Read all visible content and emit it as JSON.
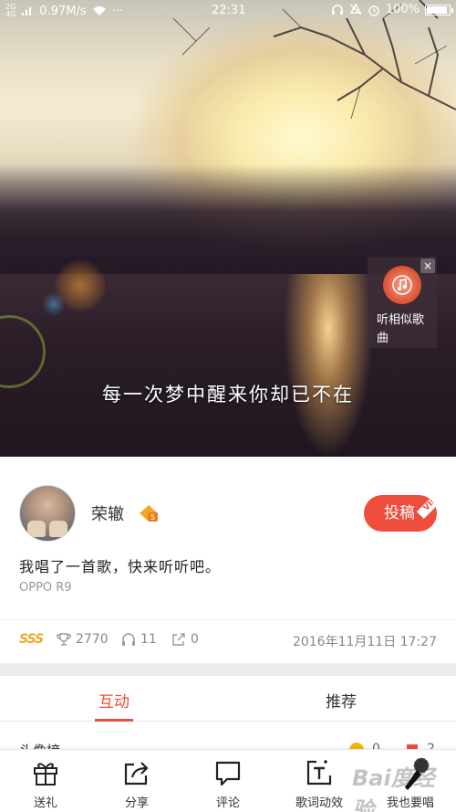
{
  "status_bar": {
    "network": "2G",
    "network2": "4G",
    "speed": "0.97M/s",
    "more": "···",
    "time": "22:31",
    "battery": "100%",
    "battery_level": 1.0
  },
  "hero": {
    "lyric": "每一次梦中醒来你却已不在",
    "similar_songs": {
      "label": "听相似歌曲",
      "close": "×"
    }
  },
  "post": {
    "username": "荣辙",
    "level_badge": "5",
    "submit_button": "投稿",
    "vip_tag": "VIP",
    "message": "我唱了一首歌，快来听听吧。",
    "device": "OPPO R9"
  },
  "stats": {
    "rank": "SSS",
    "trophy_count": "2770",
    "listen_count": "11",
    "share_count": "0",
    "date": "2016年11月11日  17:27"
  },
  "tabs": [
    {
      "label": "互动",
      "active": true
    },
    {
      "label": "推荐",
      "active": false
    }
  ],
  "peek_row": {
    "text": "头像榜",
    "count1": "0",
    "count2": "2"
  },
  "bottom_bar": [
    {
      "label": "送礼",
      "icon": "gift-icon"
    },
    {
      "label": "分享",
      "icon": "share-icon"
    },
    {
      "label": "评论",
      "icon": "comment-icon"
    },
    {
      "label": "歌词动效",
      "icon": "lyric-effect-icon"
    },
    {
      "label": "我也要唱",
      "icon": "mic-icon"
    }
  ],
  "watermark": "Bai度经验",
  "colors": {
    "accent": "#ef4d3c",
    "rank_gold": "#f5a623"
  }
}
